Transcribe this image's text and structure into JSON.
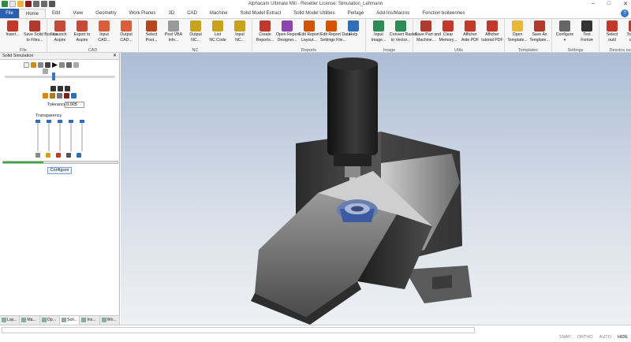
{
  "app": {
    "title": "Alphacam Ultimate Mill - Reseller License: Simulation_Lehmann",
    "help_label": "?"
  },
  "window_controls": {
    "minimize": "–",
    "maximize": "□",
    "close": "✕"
  },
  "quick_access": [
    {
      "icon": "alphacam-logo-icon",
      "color": "#2e8b3e"
    },
    {
      "icon": "new-file-icon",
      "color": "#e9e9e9"
    },
    {
      "icon": "open-folder-icon",
      "color": "#e8b73a"
    },
    {
      "icon": "save-icon",
      "color": "#8a1c1c"
    },
    {
      "icon": "undo-icon",
      "color": "#6b6b6b"
    },
    {
      "icon": "redo-icon",
      "color": "#6b6b6b"
    },
    {
      "icon": "customize-dropdown-icon",
      "color": "#555555"
    }
  ],
  "tabs": [
    "File",
    "Home",
    "Edit",
    "View",
    "Geometry",
    "Work Planes",
    "3D",
    "CAD",
    "Machine",
    "Solid Model Extract",
    "Solid Model Utilities",
    "Perlage",
    "Add-Ins/Macros",
    "Fonction boiteennes"
  ],
  "active_tab": "Home",
  "ribbon": {
    "groups": [
      {
        "name": "File",
        "buttons": [
          {
            "label": [
              "Insert...",
              ""
            ],
            "icon": "insert-icon",
            "color": "#c0392b"
          },
          {
            "label": [
              "Save Solid Bodies",
              "to Files..."
            ],
            "icon": "save-solid-bodies-icon",
            "color": "#b03a2e"
          }
        ]
      },
      {
        "name": "CAD",
        "buttons": [
          {
            "label": [
              "Launch",
              "Aspire"
            ],
            "icon": "launch-aspire-icon",
            "color": "#c44a3a"
          },
          {
            "label": [
              "Export to",
              "Aspire"
            ],
            "icon": "export-aspire-icon",
            "color": "#c44a3a"
          },
          {
            "label": [
              "Input",
              "CAD..."
            ],
            "icon": "input-cad-icon",
            "color": "#d95e3c"
          },
          {
            "label": [
              "Output",
              "CAD..."
            ],
            "icon": "output-cad-icon",
            "color": "#d95e3c"
          }
        ]
      },
      {
        "name": "NC",
        "buttons": [
          {
            "label": [
              "Select",
              "Post..."
            ],
            "icon": "select-post-icon",
            "color": "#b7451f"
          },
          {
            "label": [
              "Post VBA",
              "info..."
            ],
            "icon": "post-vba-icon",
            "color": "#9a9a9a"
          },
          {
            "label": [
              "Output",
              "NC..."
            ],
            "icon": "output-nc-icon",
            "color": "#c7a21c"
          },
          {
            "label": [
              "List",
              "NC Code"
            ],
            "icon": "list-nc-icon",
            "color": "#c7a21c"
          },
          {
            "label": [
              "Input",
              "NC..."
            ],
            "icon": "input-nc-icon",
            "color": "#c7a21c"
          }
        ]
      },
      {
        "name": "Reports",
        "buttons": [
          {
            "label": [
              "Create",
              "Reports..."
            ],
            "icon": "create-reports-icon",
            "color": "#c0392b"
          },
          {
            "label": [
              "Open Report",
              "Designer..."
            ],
            "icon": "open-report-designer-icon",
            "color": "#8e44ad"
          },
          {
            "label": [
              "Edit Report",
              "Layout..."
            ],
            "icon": "edit-report-layout-icon",
            "color": "#d35400"
          },
          {
            "label": [
              "Edit Report Data",
              "Settings File..."
            ],
            "icon": "edit-report-data-icon",
            "color": "#d35400"
          },
          {
            "label": [
              "Help",
              ""
            ],
            "icon": "help-book-icon",
            "color": "#2e6fb8"
          }
        ]
      },
      {
        "name": "Image",
        "buttons": [
          {
            "label": [
              "Input",
              "Image..."
            ],
            "icon": "input-image-icon",
            "color": "#2e8b57"
          },
          {
            "label": [
              "Convert Raster",
              "to Vector..."
            ],
            "icon": "convert-raster-icon",
            "color": "#2e8b57"
          }
        ]
      },
      {
        "name": "Utils",
        "buttons": [
          {
            "label": [
              "Save Part and",
              "Machine..."
            ],
            "icon": "save-part-machine-icon",
            "color": "#b03a2e"
          },
          {
            "label": [
              "Clear",
              "Memory..."
            ],
            "icon": "clear-memory-icon",
            "color": "#c0392b"
          },
          {
            "label": [
              "Afficher",
              "Aide PDF"
            ],
            "icon": "pdf-help-icon",
            "color": "#c0392b"
          },
          {
            "label": [
              "Afficher",
              "tutorial PDF"
            ],
            "icon": "pdf-tutorial-icon",
            "color": "#c0392b"
          }
        ]
      },
      {
        "name": "Templates",
        "buttons": [
          {
            "label": [
              "Open",
              "Template..."
            ],
            "icon": "open-template-icon",
            "color": "#e8b73a"
          },
          {
            "label": [
              "Save As",
              "Template..."
            ],
            "icon": "save-template-icon",
            "color": "#b03a2e"
          }
        ]
      },
      {
        "name": "Settings",
        "buttons": [
          {
            "label": [
              "Configure",
              "▾"
            ],
            "icon": "gear-icon",
            "color": "#666666"
          },
          {
            "label": [
              "Text",
              "Fonts▾"
            ],
            "icon": "text-fonts-icon",
            "color": "#333333"
          }
        ]
      },
      {
        "name": "Dessins outils",
        "buttons": [
          {
            "label": [
              "Select",
              "outil"
            ],
            "icon": "select-tool-icon",
            "color": "#c0392b"
          },
          {
            "label": [
              "Tous les",
              "outils"
            ],
            "icon": "all-tools-icon",
            "color": "#c0392b"
          }
        ]
      }
    ]
  },
  "panel": {
    "title": "Solid Simulation",
    "close": "✕",
    "tolerance_label": "Tolerance",
    "tolerance_value": "0.005",
    "transparency_label": "Transparency",
    "sliders": [
      {
        "name": "stock",
        "level": 0
      },
      {
        "name": "part",
        "level": 0
      },
      {
        "name": "fixture",
        "level": 0
      },
      {
        "name": "machine",
        "level": 0
      },
      {
        "name": "tool",
        "level": 0
      }
    ],
    "progress": 0.35,
    "configure_label": "Configure"
  },
  "panel_tabs": [
    {
      "label": "Lay...",
      "active": false
    },
    {
      "label": "Ma...",
      "active": false
    },
    {
      "label": "Op...",
      "active": false
    },
    {
      "label": "Soli...",
      "active": true
    },
    {
      "label": "Ins...",
      "active": false
    },
    {
      "label": "Wo...",
      "active": false
    }
  ],
  "status": {
    "command_placeholder": "",
    "toggles": [
      {
        "label": "SNAP",
        "on": false
      },
      {
        "label": "ORTHO",
        "on": false
      },
      {
        "label": "AUTO",
        "on": false
      },
      {
        "label": "HIDE",
        "on": true
      }
    ]
  },
  "colors": {
    "accent": "#2a5fb0",
    "progress": "#2fae34",
    "slider": "#2d6cc0"
  }
}
